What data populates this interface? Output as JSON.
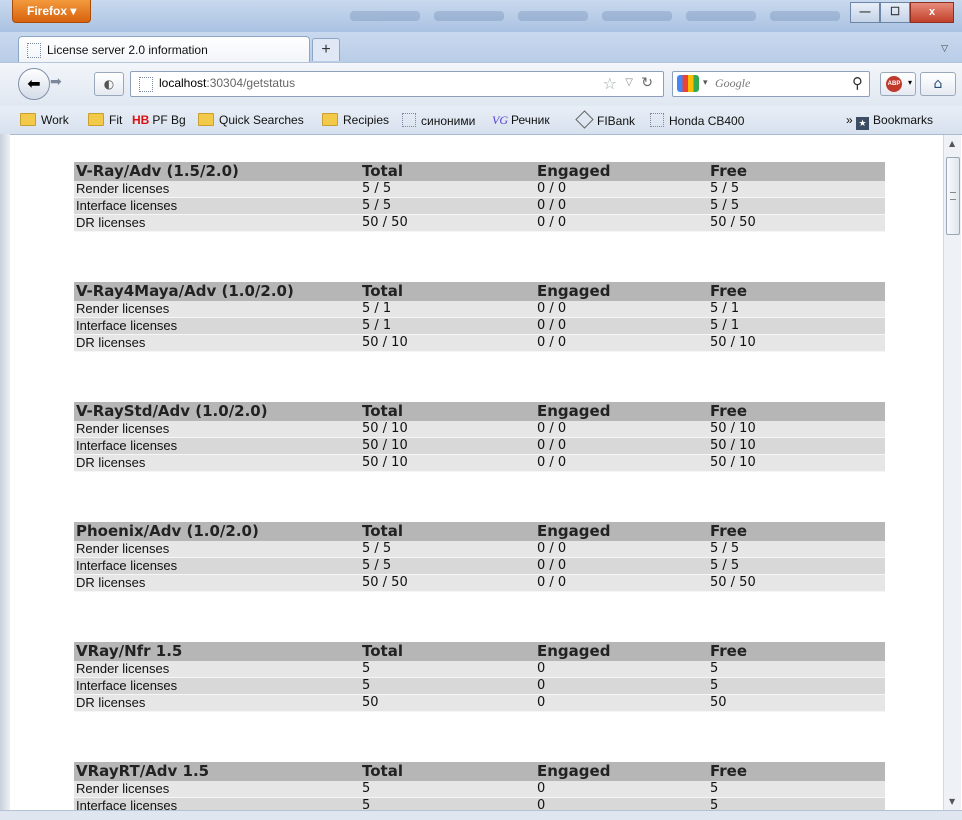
{
  "browser": {
    "menu_button": "Firefox",
    "window_buttons": {
      "minimize": "—",
      "maximize": "☐",
      "close": "x"
    },
    "tab": {
      "title": "License server 2.0 information"
    },
    "new_tab": "+",
    "address": {
      "host": "localhost",
      "rest": ":30304/getstatus"
    },
    "search": {
      "placeholder": "Google"
    },
    "bookmarks": [
      {
        "label": "Work",
        "icon": "folder-icon"
      },
      {
        "label": "Fit",
        "icon": "folder-icon"
      },
      {
        "label": "PF Bg",
        "icon": "hb-icon",
        "icon_text": "HB"
      },
      {
        "label": "Quick Searches",
        "icon": "folder-icon"
      },
      {
        "label": "Recipies",
        "icon": "folder-icon"
      },
      {
        "label": "синоними",
        "icon": "page-icon"
      },
      {
        "label": "Речник",
        "icon": "vg-icon",
        "icon_text": "VG"
      },
      {
        "label": "FIBank",
        "icon": "fibank-icon"
      },
      {
        "label": "Honda CB400",
        "icon": "page-icon"
      }
    ],
    "bookmarks_menu": {
      "chevron": "»",
      "label": "Bookmarks"
    }
  },
  "page": {
    "column_headers": {
      "total": "Total",
      "engaged": "Engaged",
      "free": "Free"
    },
    "products": [
      {
        "name": "V-Ray/Adv (1.5/2.0)",
        "rows": [
          {
            "label": "Render licenses",
            "total": "5 / 5",
            "engaged": "0 / 0",
            "free": "5 / 5"
          },
          {
            "label": "Interface licenses",
            "total": "5 / 5",
            "engaged": "0 / 0",
            "free": "5 / 5"
          },
          {
            "label": "DR licenses",
            "total": "50 / 50",
            "engaged": "0 / 0",
            "free": "50 / 50"
          }
        ]
      },
      {
        "name": "V-Ray4Maya/Adv (1.0/2.0)",
        "rows": [
          {
            "label": "Render licenses",
            "total": "5 / 1",
            "engaged": "0 / 0",
            "free": "5 / 1"
          },
          {
            "label": "Interface licenses",
            "total": "5 / 1",
            "engaged": "0 / 0",
            "free": "5 / 1"
          },
          {
            "label": "DR licenses",
            "total": "50 / 10",
            "engaged": "0 / 0",
            "free": "50 / 10"
          }
        ]
      },
      {
        "name": "V-RayStd/Adv (1.0/2.0)",
        "rows": [
          {
            "label": "Render licenses",
            "total": "50 / 10",
            "engaged": "0 / 0",
            "free": "50 / 10"
          },
          {
            "label": "Interface licenses",
            "total": "50 / 10",
            "engaged": "0 / 0",
            "free": "50 / 10"
          },
          {
            "label": "DR licenses",
            "total": "50 / 10",
            "engaged": "0 / 0",
            "free": "50 / 10"
          }
        ]
      },
      {
        "name": "Phoenix/Adv (1.0/2.0)",
        "rows": [
          {
            "label": "Render licenses",
            "total": "5 / 5",
            "engaged": "0 / 0",
            "free": "5 / 5"
          },
          {
            "label": "Interface licenses",
            "total": "5 / 5",
            "engaged": "0 / 0",
            "free": "5 / 5"
          },
          {
            "label": "DR licenses",
            "total": "50 / 50",
            "engaged": "0 / 0",
            "free": "50 / 50"
          }
        ]
      },
      {
        "name": "VRay/Nfr 1.5",
        "rows": [
          {
            "label": "Render licenses",
            "total": "5",
            "engaged": "0",
            "free": "5"
          },
          {
            "label": "Interface licenses",
            "total": "5",
            "engaged": "0",
            "free": "5"
          },
          {
            "label": "DR licenses",
            "total": "50",
            "engaged": "0",
            "free": "50"
          }
        ]
      },
      {
        "name": "VRayRT/Adv 1.5",
        "rows": [
          {
            "label": "Render licenses",
            "total": "5",
            "engaged": "0",
            "free": "5"
          },
          {
            "label": "Interface licenses",
            "total": "5",
            "engaged": "0",
            "free": "5"
          }
        ]
      }
    ]
  }
}
